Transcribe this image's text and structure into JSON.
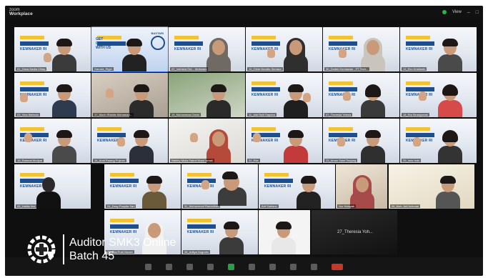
{
  "window": {
    "app_small": "zoom",
    "app_name": "Workplace",
    "view_label": "View"
  },
  "slide": {
    "word": "KEMNAKER RI",
    "brand": "BASTARI",
    "ad_title": "GET CERTIFIED WITH US"
  },
  "tiles": [
    {
      "name": "01_Hana Nadia Ulhaq"
    },
    {
      "name": "Garuda_Rigel"
    },
    {
      "name": "02_Indriana Rut... Mutiarani"
    },
    {
      "name": "10_Gilda Novalia Semara"
    },
    {
      "name": "30_Dedek Kurniawan - PT.Tech..."
    },
    {
      "name": "12_Eko Kristianto"
    },
    {
      "name": "03_Vina Melinda"
    },
    {
      "name": "17_Moch Rhizkie Mohamad..."
    },
    {
      "name": "15_Muhammad Zahid"
    },
    {
      "name": "11_Aldi Rulli Saputra"
    },
    {
      "name": "07_Theresia Yelena"
    },
    {
      "name": "18_Ria Sinanjuntak"
    },
    {
      "name": "19_Rahmat Ahdiyat"
    },
    {
      "name": "14_Andi Parang Pujiono"
    },
    {
      "name": "Nabitry Mulia Fahmi Nurul Ismail"
    },
    {
      "name": "20_Rila"
    },
    {
      "name": "23_Aman Sotel Tanjung"
    },
    {
      "name": "29_Irnia Indri"
    },
    {
      "name": "09_Hafidz Ilmi"
    },
    {
      "name": "24_Desy Puspita Sari"
    },
    {
      "name": "31_Muhammad Ramadhan"
    },
    {
      "name": "Arif Sutrisno"
    },
    {
      "name": "Nur Hidayah"
    },
    {
      "name": "06_Moh. Arif Achmad"
    },
    {
      "name": "26_Eka Putri Nurani"
    },
    {
      "name": "28_Aditya Nugroho"
    },
    {
      "name": "27_Theresia Yoh..."
    }
  ],
  "overlay": {
    "line1": "Auditor SMK3 Online",
    "line2": "Batch 45"
  },
  "colors": {
    "accent": "#2f6fe0",
    "brand": "#1d4f8e",
    "highlight": "#f1c232"
  }
}
